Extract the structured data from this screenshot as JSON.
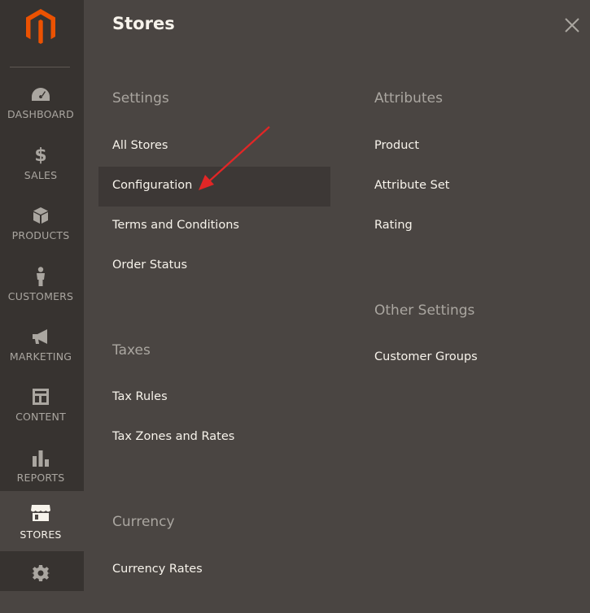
{
  "sidebar": {
    "logo": "magento-logo",
    "items": [
      {
        "label": "DASHBOARD",
        "icon": "speedometer-icon"
      },
      {
        "label": "SALES",
        "icon": "dollar-icon"
      },
      {
        "label": "PRODUCTS",
        "icon": "cube-icon"
      },
      {
        "label": "CUSTOMERS",
        "icon": "person-icon"
      },
      {
        "label": "MARKETING",
        "icon": "megaphone-icon"
      },
      {
        "label": "CONTENT",
        "icon": "layout-icon"
      },
      {
        "label": "REPORTS",
        "icon": "bar-chart-icon"
      },
      {
        "label": "STORES",
        "icon": "storefront-icon",
        "active": true
      },
      {
        "label": "",
        "icon": "gear-icon"
      }
    ]
  },
  "panel": {
    "title": "Stores",
    "close_icon": "close-icon",
    "left_column": [
      {
        "title": "Settings",
        "links": [
          "All Stores",
          "Configuration",
          "Terms and Conditions",
          "Order Status"
        ]
      },
      {
        "title": "Taxes",
        "links": [
          "Tax Rules",
          "Tax Zones and Rates"
        ]
      },
      {
        "title": "Currency",
        "links": [
          "Currency Rates"
        ]
      }
    ],
    "right_column": [
      {
        "title": "Attributes",
        "links": [
          "Product",
          "Attribute Set",
          "Rating"
        ]
      },
      {
        "title": "Other Settings",
        "links": [
          "Customer Groups"
        ]
      }
    ]
  },
  "colors": {
    "sidebar_bg": "#373330",
    "panel_bg": "#4a4542",
    "highlight_bg": "#3d3836",
    "logo_orange": "#eb5202",
    "annotation_arrow": "#e22626"
  }
}
